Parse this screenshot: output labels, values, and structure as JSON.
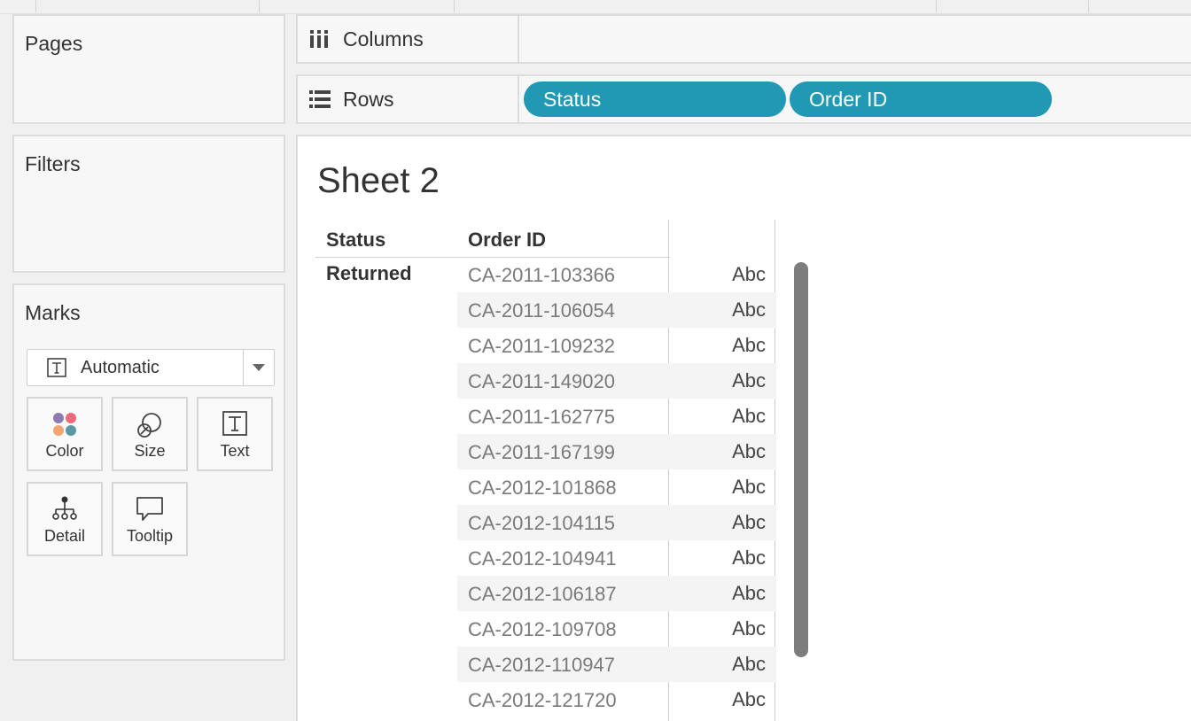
{
  "left": {
    "pages_title": "Pages",
    "filters_title": "Filters",
    "marks_title": "Marks",
    "mark_type": "Automatic",
    "mark_buttons": {
      "color": "Color",
      "size": "Size",
      "text": "Text",
      "detail": "Detail",
      "tooltip": "Tooltip"
    }
  },
  "shelves": {
    "columns_label": "Columns",
    "rows_label": "Rows",
    "rows_pills": [
      "Status",
      "Order ID"
    ]
  },
  "view": {
    "sheet_title": "Sheet 2",
    "headers": {
      "status": "Status",
      "order_id": "Order ID"
    },
    "status_value": "Returned",
    "rows": [
      {
        "order_id": "CA-2011-103366",
        "value": "Abc"
      },
      {
        "order_id": "CA-2011-106054",
        "value": "Abc"
      },
      {
        "order_id": "CA-2011-109232",
        "value": "Abc"
      },
      {
        "order_id": "CA-2011-149020",
        "value": "Abc"
      },
      {
        "order_id": "CA-2011-162775",
        "value": "Abc"
      },
      {
        "order_id": "CA-2011-167199",
        "value": "Abc"
      },
      {
        "order_id": "CA-2012-101868",
        "value": "Abc"
      },
      {
        "order_id": "CA-2012-104115",
        "value": "Abc"
      },
      {
        "order_id": "CA-2012-104941",
        "value": "Abc"
      },
      {
        "order_id": "CA-2012-106187",
        "value": "Abc"
      },
      {
        "order_id": "CA-2012-109708",
        "value": "Abc"
      },
      {
        "order_id": "CA-2012-110947",
        "value": "Abc"
      },
      {
        "order_id": "CA-2012-121720",
        "value": "Abc"
      }
    ]
  },
  "colors": {
    "pill": "#2199b5",
    "color_dots": [
      "#8f7bb3",
      "#ee6a7a",
      "#f5a46f",
      "#5b9aa3"
    ]
  }
}
